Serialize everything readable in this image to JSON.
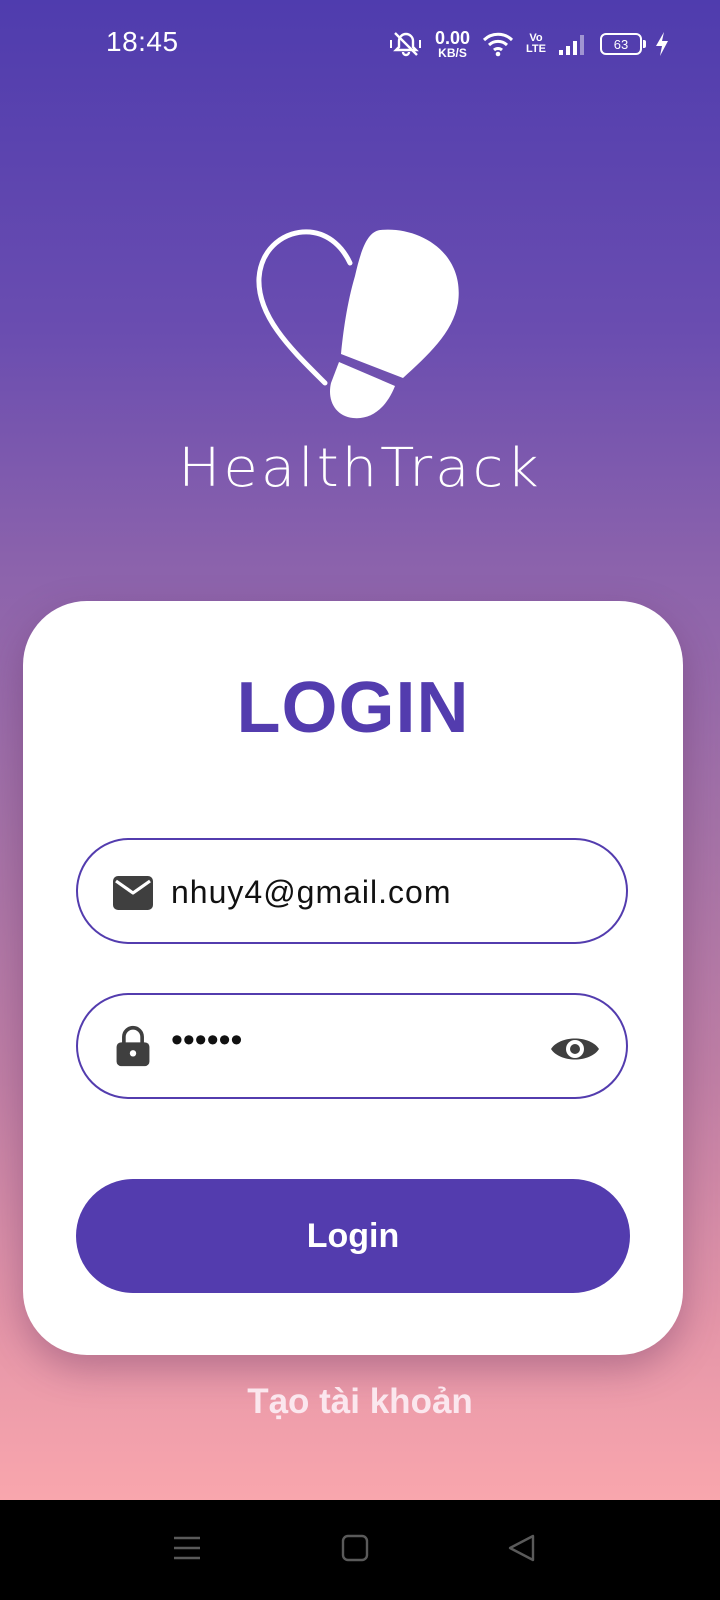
{
  "status_bar": {
    "time": "18:45",
    "net_speed_value": "0.00",
    "net_speed_unit": "KB/S",
    "volte_top": "Vo",
    "volte_bottom": "LTE",
    "battery_level": "63",
    "icons": [
      "mute-icon",
      "wifi-icon",
      "volte-icon",
      "signal-icon",
      "battery-icon",
      "charging-icon"
    ]
  },
  "brand": {
    "name": "HealthTrack",
    "logo_icon": "heart-footprint-logo"
  },
  "login_card": {
    "title": "LOGIN",
    "email": {
      "icon": "mail-icon",
      "value": "nhuy4@gmail.com"
    },
    "password": {
      "icon": "lock-icon",
      "value": "••••••",
      "toggle_icon": "eye-icon"
    },
    "login_label": "Login"
  },
  "create_account_label": "Tạo tài khoản",
  "nav_bar": {
    "buttons": [
      "menu-icon",
      "home-icon",
      "back-icon"
    ]
  },
  "colors": {
    "accent": "#533cae",
    "gradient_top": "#4f3cae",
    "gradient_bottom": "#f9a6ad",
    "card": "#ffffff"
  }
}
